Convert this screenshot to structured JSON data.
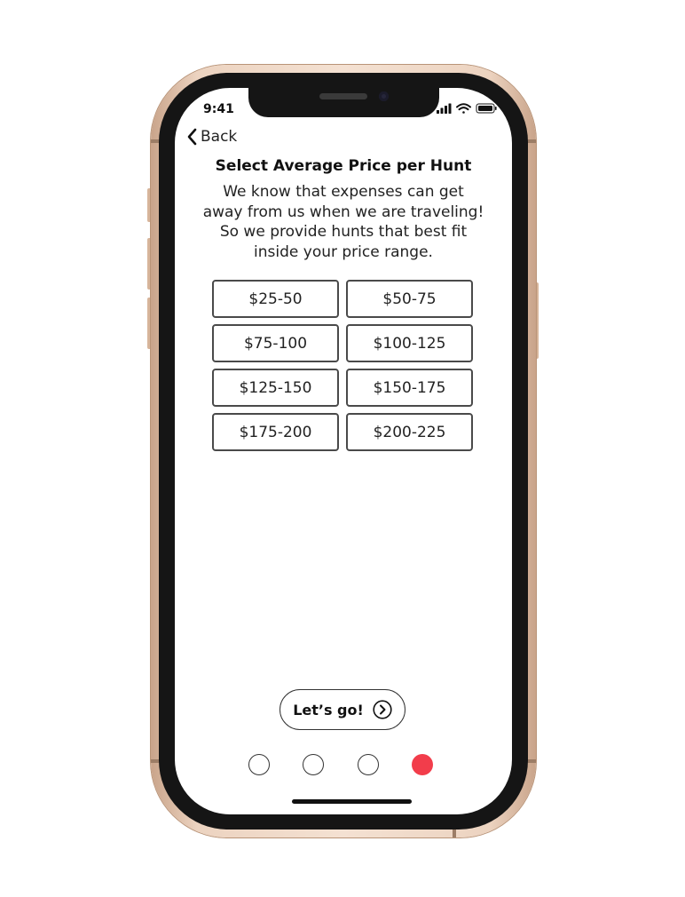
{
  "status_bar": {
    "time": "9:41"
  },
  "nav": {
    "back_label": "Back"
  },
  "header": {
    "title": "Select Average Price per Hunt",
    "subtitle_lines": [
      "We know that expenses can get",
      "away from us when we are traveling!",
      "So we provide hunts that best fit",
      "inside your price range."
    ]
  },
  "price_options": [
    "$25-50",
    "$50-75",
    "$75-100",
    "$100-125",
    "$125-150",
    "$150-175",
    "$175-200",
    "$200-225"
  ],
  "cta": {
    "label": "Let’s go!",
    "icon": "chevron-right-circle-icon"
  },
  "pager": {
    "total": 4,
    "active_index": 4,
    "active_color": "#f23d4b"
  },
  "colors": {
    "frame": "#ecd3c0",
    "bezel": "#151515",
    "button_border": "#4a4a4a"
  }
}
